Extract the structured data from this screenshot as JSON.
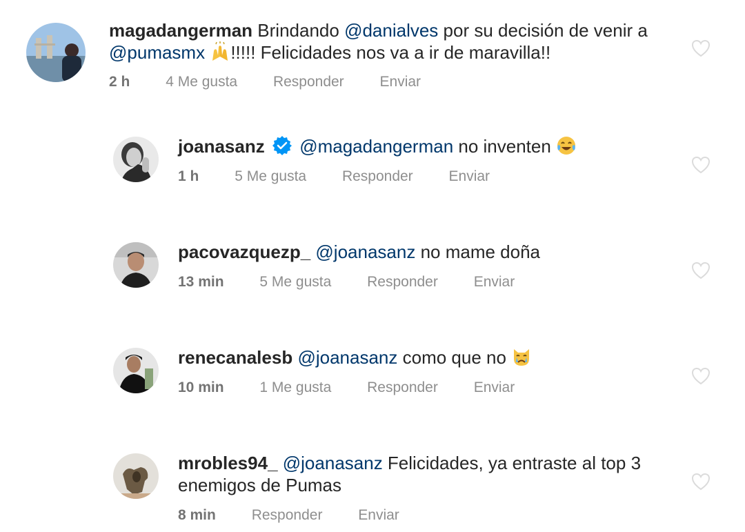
{
  "comments": [
    {
      "username": "magadangerman",
      "segments": [
        {
          "text": " Brindando "
        },
        {
          "mention": "@danialves"
        },
        {
          "text": " por su decisión de venir a "
        },
        {
          "mention": "@pumasmx"
        },
        {
          "text": " "
        },
        {
          "emoji": "raising-hands-emoji"
        },
        {
          "text": "!!!!! Felicidades nos va a ir de maravilla!!"
        }
      ],
      "text_1": " Brindando ",
      "mention_1": "@danialves",
      "text_2": " por su decisión de venir a",
      "mention_2": "@pumasmx",
      "text_3": "!!!!! Felicidades nos va a ir de maravilla!!",
      "time": "2 h",
      "likes": "4 Me gusta",
      "reply": "Responder",
      "send": "Enviar"
    },
    {
      "username": "joanasanz",
      "verified": true,
      "mention_1": "@magadangerman",
      "text_1": " no inventen ",
      "emoji": "tears-of-joy-emoji",
      "time": "1 h",
      "likes": "5 Me gusta",
      "reply": "Responder",
      "send": "Enviar"
    },
    {
      "username": "pacovazquezp_",
      "mention_1": "@joanasanz",
      "text_1": " no mame doña",
      "time": "13 min",
      "likes": "5 Me gusta",
      "reply": "Responder",
      "send": "Enviar"
    },
    {
      "username": "renecanalesb",
      "mention_1": "@joanasanz",
      "text_1": " como que no ",
      "emoji": "crying-cat-emoji",
      "time": "10 min",
      "likes": "1 Me gusta",
      "reply": "Responder",
      "send": "Enviar"
    },
    {
      "username": "mrobles94_",
      "mention_1": "@joanasanz",
      "text_1": " Felicidades, ya entraste al top 3",
      "text_2": "enemigos de Pumas",
      "time": "8 min",
      "reply": "Responder",
      "send": "Enviar"
    }
  ],
  "colors": {
    "mention": "#00376b",
    "verified": "#0095f6",
    "meta": "#8e8e8e",
    "heart_outline": "#dbdbdb"
  }
}
